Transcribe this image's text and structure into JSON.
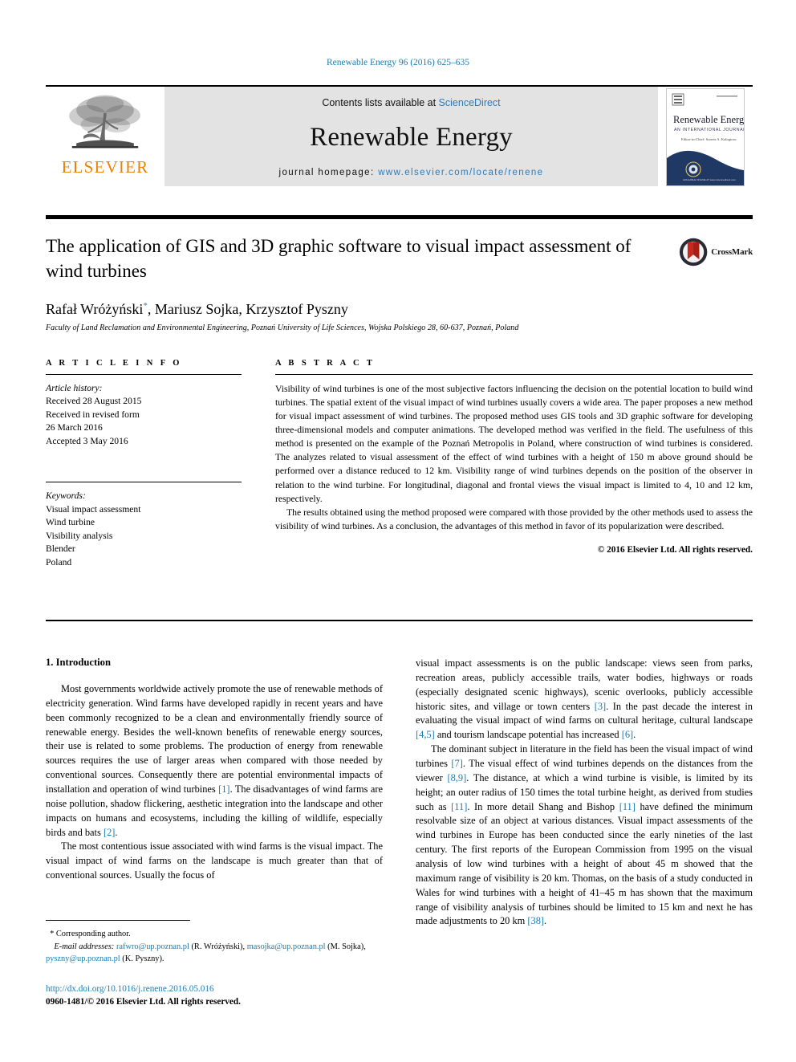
{
  "running_head": "Renewable Energy 96 (2016) 625–635",
  "masthead": {
    "publisher_name": "ELSEVIER",
    "contents_prefix": "Contents lists available at ",
    "contents_link": "ScienceDirect",
    "journal_name": "Renewable Energy",
    "homepage_prefix": "journal homepage: ",
    "homepage_url": "www.elsevier.com/locate/renene",
    "cover": {
      "title": "Renewable Energy",
      "subtitle": "AN INTERNATIONAL JOURNAL",
      "tagline": "Editor-in-Chief: Soteris A. Kalogirou",
      "footer": "AVAILABLE ONLINE AT\nwww.sciencedirect.com"
    }
  },
  "article": {
    "title": "The application of GIS and 3D graphic software to visual impact assessment of wind turbines",
    "authors": "Rafał Wróżyński",
    "authors_rest": ", Mariusz Sojka, Krzysztof Pyszny",
    "author_marker": "*",
    "affiliation": "Faculty of Land Reclamation and Environmental Engineering, Poznań University of Life Sciences, Wojska Polskiego 28, 60-637, Poznań, Poland",
    "crossmark_label": "CrossMark"
  },
  "article_info": {
    "heading": "A R T I C L E   I N F O",
    "history_label": "Article history:",
    "history": [
      "Received 28 August 2015",
      "Received in revised form",
      "26 March 2016",
      "Accepted 3 May 2016"
    ],
    "keywords_label": "Keywords:",
    "keywords": [
      "Visual impact assessment",
      "Wind turbine",
      "Visibility analysis",
      "Blender",
      "Poland"
    ]
  },
  "abstract": {
    "heading": "A B S T R A C T",
    "paragraph_1": "Visibility of wind turbines is one of the most subjective factors influencing the decision on the potential location to build wind turbines. The spatial extent of the visual impact of wind turbines usually covers a wide area. The paper proposes a new method for visual impact assessment of wind turbines. The proposed method uses GIS tools and 3D graphic software for developing three-dimensional models and computer animations. The developed method was verified in the field. The usefulness of this method is presented on the example of the Poznań Metropolis in Poland, where construction of wind turbines is considered. The analyzes related to visual assessment of the effect of wind turbines with a height of 150 m above ground should be performed over a distance reduced to 12 km. Visibility range of wind turbines depends on the position of the observer in relation to the wind turbine. For longitudinal, diagonal and frontal views the visual impact is limited to 4, 10 and 12 km, respectively.",
    "paragraph_2": "The results obtained using the method proposed were compared with those provided by the other methods used to assess the visibility of wind turbines. As a conclusion, the advantages of this method in favor of its popularization were described.",
    "copyright": "© 2016 Elsevier Ltd. All rights reserved."
  },
  "introduction": {
    "section_title": "1. Introduction",
    "left_p1_a": "Most governments worldwide actively promote the use of renewable methods of electricity generation. Wind farms have developed rapidly in recent years and have been commonly recognized to be a clean and environmentally friendly source of renewable energy. Besides the well-known benefits of renewable energy sources, their use is related to some problems. The production of energy from renewable sources requires the use of larger areas when compared with those needed by conventional sources. Consequently there are potential environmental impacts of installation and operation of wind turbines ",
    "cite_1": "[1]",
    "left_p1_b": ". The disadvantages of wind farms are noise pollution, shadow flickering, aesthetic integration into the landscape and other impacts on humans and ecosystems, including the killing of wildlife, especially birds and bats ",
    "cite_2": "[2]",
    "left_p1_c": ".",
    "left_p2": "The most contentious issue associated with wind farms is the visual impact. The visual impact of wind farms on the landscape is much greater than that of conventional sources. Usually the focus of",
    "right_p1_a": "visual impact assessments is on the public landscape: views seen from parks, recreation areas, publicly accessible trails, water bodies, highways or roads (especially designated scenic highways), scenic overlooks, publicly accessible historic sites, and village or town centers ",
    "cite_3": "[3]",
    "right_p1_b": ". In the past decade the interest in evaluating the visual impact of wind farms on cultural heritage, cultural landscape ",
    "cite_45": "[4,5]",
    "right_p1_c": " and tourism landscape potential has increased ",
    "cite_6": "[6]",
    "right_p1_d": ".",
    "right_p2_a": "The dominant subject in literature in the field has been the visual impact of wind turbines ",
    "cite_7": "[7]",
    "right_p2_b": ". The visual effect of wind turbines depends on the distances from the viewer ",
    "cite_89": "[8,9]",
    "right_p2_c": ". The distance, at which a wind turbine is visible, is limited by its height; an outer radius of 150 times the total turbine height, as derived from studies such as ",
    "cite_11a": "[11]",
    "right_p2_d": ". In more detail Shang and Bishop ",
    "cite_11b": "[11]",
    "right_p2_e": " have defined the minimum resolvable size of an object at various distances. Visual impact assessments of the wind turbines in Europe has been conducted since the early nineties of the last century. The first reports of the European Commission from 1995 on the visual analysis of low wind turbines with a height of about 45 m showed that the maximum range of visibility is 20 km. Thomas, on the basis of a study conducted in Wales for wind turbines with a height of 41–45 m has shown that the maximum range of visibility analysis of turbines should be limited to 15 km and next he has made adjustments to 20 km ",
    "cite_38": "[38]",
    "right_p2_f": "."
  },
  "footnotes": {
    "corresponding_marker": "*",
    "corresponding_label": "Corresponding author.",
    "email_label": "E-mail addresses:",
    "email_1": "rafwro@up.poznan.pl",
    "email_1_owner": " (R. Wróżyński), ",
    "email_2": "masojka@up.poznan.pl",
    "email_2_owner": " (M. Sojka), ",
    "email_3": "pyszny@up.poznan.pl",
    "email_3_owner": " (K. Pyszny)."
  },
  "bottom": {
    "doi": "http://dx.doi.org/10.1016/j.renene.2016.05.016",
    "issn_line": "0960-1481/© 2016 Elsevier Ltd. All rights reserved."
  },
  "colors": {
    "link": "#2b7bba",
    "cite": "#1a7db6",
    "elsevier_orange": "#f08000",
    "masthead_grey": "#e3e3e3",
    "cover_navy": "#1f3864"
  }
}
